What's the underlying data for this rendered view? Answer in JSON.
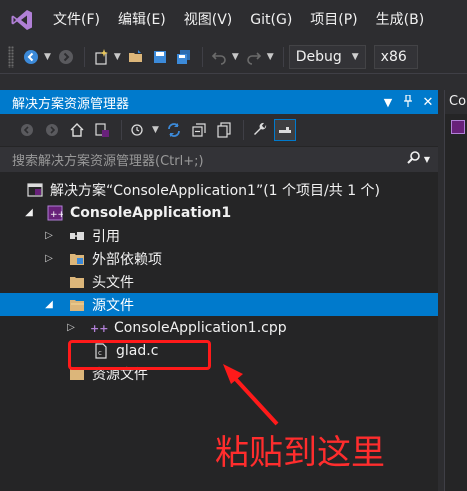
{
  "menu": {
    "items": [
      "文件(F)",
      "编辑(E)",
      "视图(V)",
      "Git(G)",
      "项目(P)",
      "生成(B)"
    ]
  },
  "toolbar": {
    "config": "Debug",
    "platform": "x86"
  },
  "solution_explorer": {
    "title": "解决方案资源管理器",
    "search_placeholder": "搜索解决方案资源管理器(Ctrl+;)",
    "tree": {
      "solution": "解决方案“ConsoleApplication1”(1 个项目/共 1 个)",
      "project": "ConsoleApplication1",
      "references": "引用",
      "external_deps": "外部依赖项",
      "header_files": "头文件",
      "source_files": "源文件",
      "cpp_file": "ConsoleApplication1.cpp",
      "c_file": "glad.c",
      "resource_files": "资源文件"
    }
  },
  "right_panel": {
    "tab": "Co"
  },
  "annotation": {
    "text": "粘贴到这里"
  }
}
